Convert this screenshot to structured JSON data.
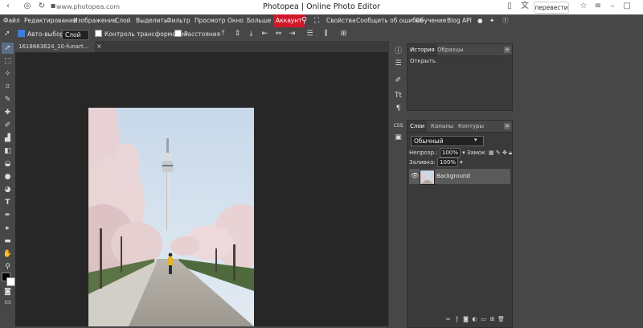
{
  "browser": {
    "url": "www.photopea.com",
    "page_title": "Photopea | Online Photo Editor",
    "translate_label": "перевести"
  },
  "menu": {
    "items": [
      "Файл",
      "Редактирование",
      "Изображение",
      "Слой",
      "Выделить",
      "Фильтр",
      "Просмотр",
      "Окно",
      "Больше"
    ],
    "account_label": "Аккаунт",
    "right_items": [
      "Свойства",
      "Сообщить об ошибке",
      "Обучение",
      "Blog",
      "API"
    ]
  },
  "options": {
    "auto_select_label": "Авто-выбор",
    "auto_select_value": "Слой",
    "transform_controls_label": "Контроль трансформации",
    "distances_label": "Расстояния"
  },
  "document": {
    "tab_name": "1618663624_10-funart...",
    "close_glyph": "×"
  },
  "history_panel": {
    "tabs": [
      "История",
      "Образцы"
    ],
    "items": [
      "Открыть"
    ]
  },
  "layers_panel": {
    "tabs": [
      "Слои",
      "Каналы",
      "Контуры"
    ],
    "blend_mode": "Обычный",
    "opacity_label": "Непрозр.:",
    "opacity_value": "100%",
    "lock_label": "Замок:",
    "fill_label": "Заливка:",
    "fill_value": "100%",
    "layers": [
      {
        "name": "Background"
      }
    ]
  },
  "colors": {
    "accent_red": "#d0172a",
    "panel_bg": "#474747",
    "canvas_bg": "#272727",
    "checkbox_blue": "#3c7dd9"
  },
  "icons": [
    "move-tool-icon",
    "marquee-tool-icon",
    "lasso-tool-icon",
    "crop-tool-icon",
    "eyedropper-icon",
    "healing-icon",
    "brush-icon",
    "stamp-icon",
    "eraser-icon",
    "bucket-icon",
    "blur-icon",
    "dodge-icon",
    "pen-icon",
    "type-icon",
    "path-select-icon",
    "shape-icon",
    "hand-icon",
    "zoom-icon",
    "info-icon",
    "sliders-icon",
    "brush-settings-icon",
    "character-icon",
    "paragraph-icon",
    "css-icon",
    "image-icon",
    "search-icon",
    "fullscreen-icon",
    "reddit-icon",
    "twitter-icon",
    "facebook-icon"
  ]
}
